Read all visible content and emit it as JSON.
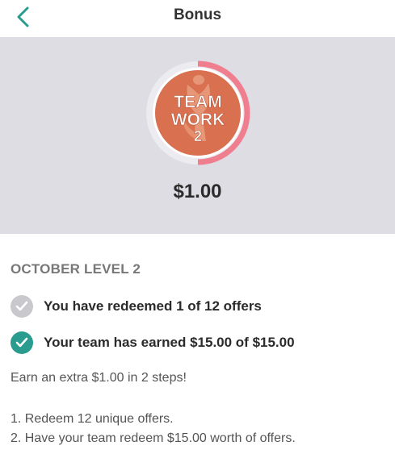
{
  "header": {
    "title": "Bonus",
    "back_icon": "chevron-left-icon"
  },
  "hero": {
    "badge": {
      "icon": "team-work-trophy-badge",
      "text_line1": "TEAM",
      "text_line2": "WORK",
      "text_line3": "2",
      "progress_fraction": 0.5
    },
    "amount": "$1.00"
  },
  "level": {
    "title": "OCTOBER LEVEL 2"
  },
  "requirements": [
    {
      "label": "You have redeemed 1 of 12 offers",
      "completed": false
    },
    {
      "label": "Your team has earned $15.00 of $15.00",
      "completed": true
    }
  ],
  "description": "Earn an extra $1.00 in 2 steps!",
  "steps": [
    "1. Redeem 12 unique offers.",
    "2. Have your team redeem $15.00 worth of offers."
  ],
  "colors": {
    "accent": "#2a9c8f",
    "progress": "#ef7f8f",
    "hero_bg": "#dedde3",
    "incomplete_check": "#c9c9cd"
  }
}
